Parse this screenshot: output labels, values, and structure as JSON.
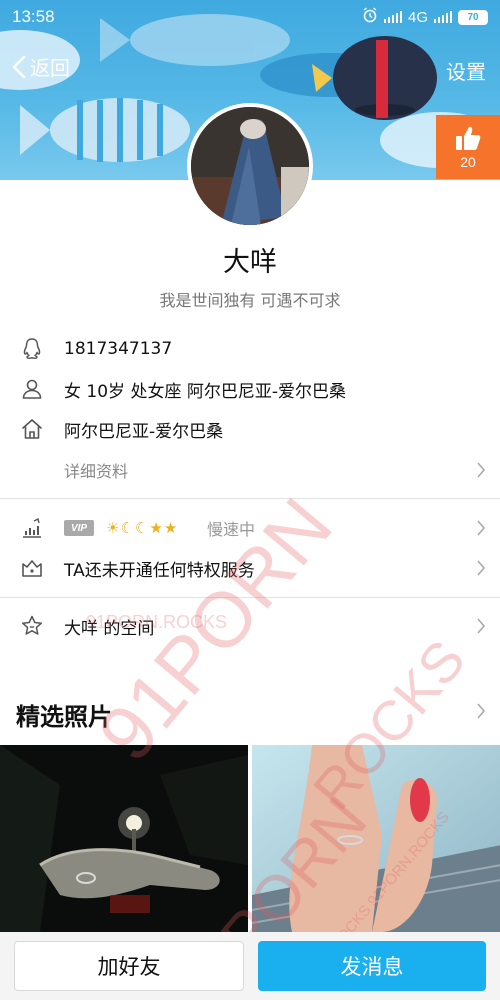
{
  "status_bar": {
    "time": "13:58",
    "network": "4G",
    "battery": "70"
  },
  "nav": {
    "back_label": "返回",
    "settings_label": "设置"
  },
  "likes": {
    "count": "20"
  },
  "profile": {
    "nickname": "大咩",
    "signature": "我是世间独有 可遇不可求"
  },
  "info": {
    "qq": "1817347137",
    "basic": "女  10岁  处女座  阿尔巴尼亚-爱尔巴桑",
    "hometown": "阿尔巴尼亚-爱尔巴桑",
    "details_label": "详细资料"
  },
  "vip": {
    "tag": "VIP",
    "level_icons": "sun moon moon star star",
    "speed_text": "慢速中",
    "privilege_text": "TA还未开通任何特权服务"
  },
  "space": {
    "label": "大咩 的空间"
  },
  "photos": {
    "title": "精选照片"
  },
  "watermarks": {
    "w1": "91PORN.ROCKS",
    "w2": "91PORN",
    "w3": "ROCKS",
    "w4": "91PORN",
    "w5": "91PORN.ROCKS 91PORN.ROCKS"
  },
  "actions": {
    "add_friend": "加好友",
    "send_message": "发消息"
  },
  "colors": {
    "banner": "#3fa9df",
    "like_box": "#f5732a",
    "primary_button": "#1ab0f0"
  }
}
